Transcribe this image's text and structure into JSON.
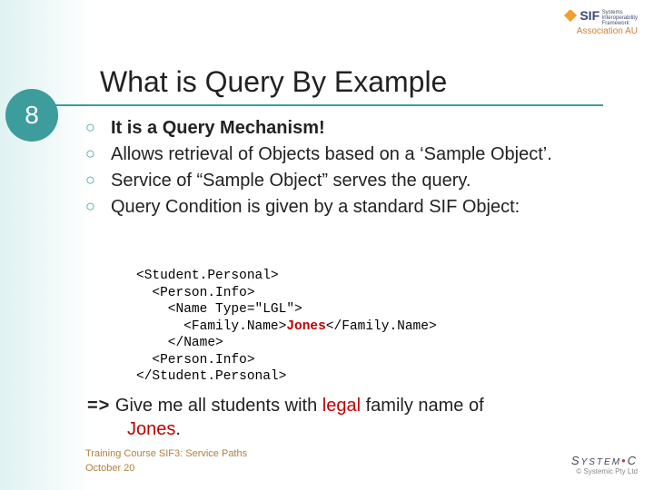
{
  "page_number": "8",
  "logo_top": {
    "main": "SIF",
    "tag1": "Systems",
    "tag2": "Interoperability",
    "tag3": "Framework",
    "sub": "Association AU"
  },
  "title": "What is Query By Example",
  "bullets": [
    {
      "bold": true,
      "text": "It is a Query Mechanism!"
    },
    {
      "bold": false,
      "text": "Allows retrieval of Objects based on a ‘Sample Object’."
    },
    {
      "bold": false,
      "text": "Service of “Sample Object” serves the query."
    },
    {
      "bold": false,
      "text": "Query Condition is given by a standard SIF Object:"
    }
  ],
  "code": {
    "l1": "<Student.Personal>",
    "l2": "  <Person.Info>",
    "l3a": "    <Name Type=",
    "l3b": "\"LGL\"",
    "l3c": ">",
    "l4a": "      <Family.Name>",
    "l4b": "Jones",
    "l4c": "</Family.Name>",
    "l5": "    </Name>",
    "l6": "  <Person.Info>",
    "l7": "</Student.Personal>"
  },
  "summary": {
    "arrow": "=>",
    "part1": " Give me all students with ",
    "legal": "legal",
    "part2": " family name of ",
    "jones": "Jones",
    "part3": "."
  },
  "footer_left": {
    "line1": "Training Course SIF3: Service Paths",
    "line2": "October 20"
  },
  "footer_right": {
    "brand_pre": "S",
    "brand_mid": "YSTEM",
    "brand_dot": "•",
    "brand_post": "C",
    "copy": "© Systemic Pty Ltd"
  }
}
